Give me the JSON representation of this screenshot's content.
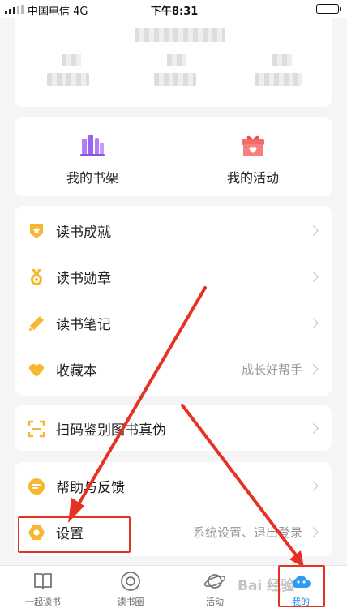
{
  "status_bar": {
    "carrier": "中国电信  4G",
    "time": "下午8:31"
  },
  "quick_actions": [
    {
      "label": "我的书架",
      "icon": "bookshelf-icon",
      "color": "#a56ef2"
    },
    {
      "label": "我的活动",
      "icon": "gift-icon",
      "color": "#f2585a"
    }
  ],
  "menu_group_1": [
    {
      "label": "读书成就",
      "icon": "achievement-badge-icon",
      "value": ""
    },
    {
      "label": "读书勋章",
      "icon": "medal-icon",
      "value": ""
    },
    {
      "label": "读书笔记",
      "icon": "pencil-icon",
      "value": ""
    },
    {
      "label": "收藏本",
      "icon": "heart-icon",
      "value": "成长好帮手"
    }
  ],
  "menu_group_2": [
    {
      "label": "扫码鉴别图书真伪",
      "icon": "scan-icon"
    }
  ],
  "menu_group_3": [
    {
      "label": "帮助与反馈",
      "icon": "feedback-icon",
      "value": ""
    },
    {
      "label": "设置",
      "icon": "settings-hexagon-icon",
      "value": "系统设置、退出登录"
    }
  ],
  "tab_bar": [
    {
      "label": "一起读书",
      "icon": "book-icon",
      "active": false
    },
    {
      "label": "读书圈",
      "icon": "circle-icon",
      "active": false
    },
    {
      "label": "活动",
      "icon": "planet-icon",
      "active": false
    },
    {
      "label": "我的",
      "icon": "profile-cloud-icon",
      "active": true
    }
  ],
  "watermark": "Bai 经验",
  "colors": {
    "accent": "#f7b733",
    "annotation": "#e53224",
    "active_tab": "#1f8ff0"
  }
}
